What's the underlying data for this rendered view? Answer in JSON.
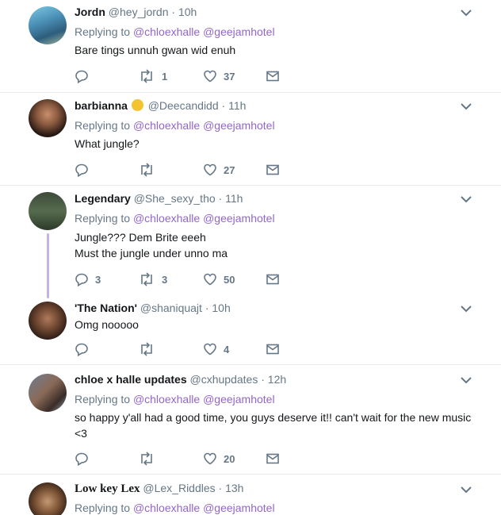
{
  "tweets": [
    {
      "name": "Jordn",
      "handle": "@hey_jordn",
      "time": "10h",
      "replying_prefix": "Replying to",
      "mentions": [
        "@chloexhalle",
        "@geejamhotel"
      ],
      "text": [
        "Bare tings unnuh gwan wid enuh"
      ],
      "reply_count": "",
      "retweet_count": "1",
      "like_count": "37"
    },
    {
      "name": "barbianna",
      "handle": "@Deecandidd",
      "time": "11h",
      "replying_prefix": "Replying to",
      "mentions": [
        "@chloexhalle",
        "@geejamhotel"
      ],
      "text": [
        "What jungle?"
      ],
      "reply_count": "",
      "retweet_count": "",
      "like_count": "27"
    },
    {
      "name": "Legendary",
      "handle": "@She_sexy_tho",
      "time": "11h",
      "replying_prefix": "Replying to",
      "mentions": [
        "@chloexhalle",
        "@geejamhotel"
      ],
      "text": [
        "Jungle??? Dem Brite eeeh",
        "Must the jungle under unno ma"
      ],
      "reply_count": "3",
      "retweet_count": "3",
      "like_count": "50"
    },
    {
      "name": "'The Nation'",
      "handle": "@shaniquajt",
      "time": "10h",
      "text": [
        "Omg nooooo"
      ],
      "reply_count": "",
      "retweet_count": "",
      "like_count": "4"
    },
    {
      "name": "chloe x halle updates",
      "handle": "@cxhupdates",
      "time": "12h",
      "replying_prefix": "Replying to",
      "mentions": [
        "@chloexhalle",
        "@geejamhotel"
      ],
      "text": [
        "so happy y'all had a good time, you guys deserve it!! can't wait for the new music",
        "<3"
      ],
      "reply_count": "",
      "retweet_count": "",
      "like_count": "20"
    },
    {
      "name": "Low key Lex",
      "handle": "@Lex_Riddles",
      "time": "13h",
      "replying_prefix": "Replying to",
      "mentions": [
        "@chloexhalle",
        "@geejamhotel"
      ]
    }
  ],
  "dot": "·",
  "icons": {
    "reply": "reply-icon",
    "retweet": "retweet-icon",
    "like": "heart-icon",
    "dm": "envelope-icon",
    "caret": "chevron-down-icon"
  },
  "colors": {
    "mention": "#9266cc",
    "muted": "#657786",
    "thread": "#c8b2e4"
  }
}
